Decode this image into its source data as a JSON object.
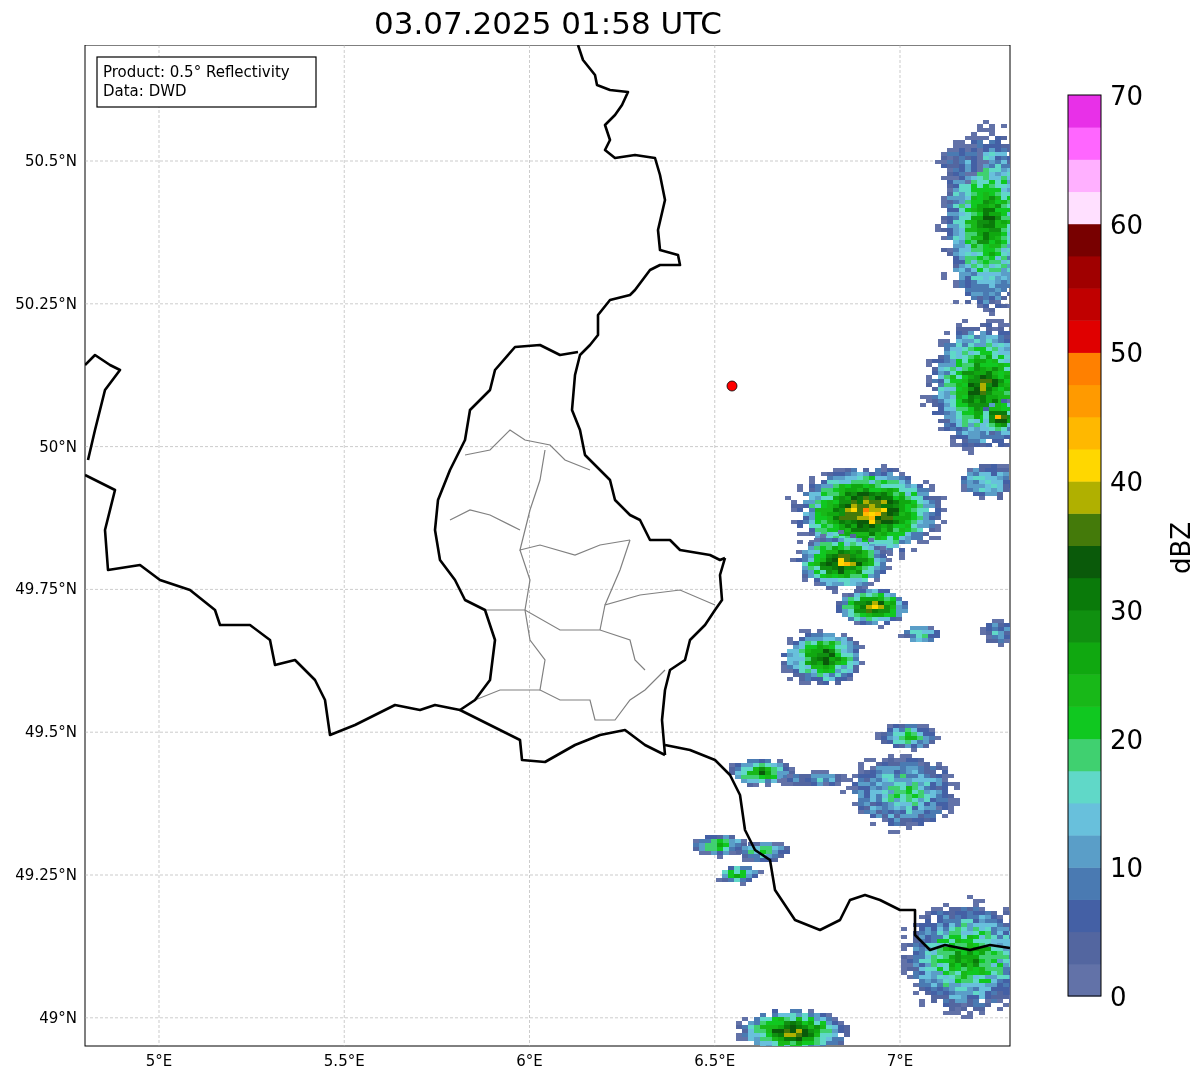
{
  "title": "03.07.2025 01:58 UTC",
  "info_box": {
    "lines": [
      "Product: 0.5° Reflectivity",
      "Data: DWD"
    ]
  },
  "map": {
    "x_ticks": [
      "5°E",
      "5.5°E",
      "6°E",
      "6.5°E",
      "7°E"
    ],
    "y_ticks": [
      "50.5°N",
      "50.25°N",
      "50°N",
      "49.75°N",
      "49.5°N",
      "49.25°N",
      "49°N"
    ]
  },
  "colorbar": {
    "label": "dBZ",
    "ticks": [
      "70",
      "60",
      "50",
      "40",
      "30",
      "20",
      "10",
      "0"
    ],
    "bands": [
      {
        "color": "#6272a8"
      },
      {
        "color": "#5366a0"
      },
      {
        "color": "#4460a5"
      },
      {
        "color": "#4a7ab2"
      },
      {
        "color": "#5a9ec8"
      },
      {
        "color": "#68c0dc"
      },
      {
        "color": "#60d8c8"
      },
      {
        "color": "#40d070"
      },
      {
        "color": "#10c820"
      },
      {
        "color": "#18b818"
      },
      {
        "color": "#10a810"
      },
      {
        "color": "#109010"
      },
      {
        "color": "#0a7a0a"
      },
      {
        "color": "#0a5a0a"
      },
      {
        "color": "#447a0a"
      },
      {
        "color": "#b0b000"
      },
      {
        "color": "#ffd700"
      },
      {
        "color": "#ffb800"
      },
      {
        "color": "#ff9a00"
      },
      {
        "color": "#ff8000"
      },
      {
        "color": "#e00000"
      },
      {
        "color": "#c00000"
      },
      {
        "color": "#a00000"
      },
      {
        "color": "#780000"
      },
      {
        "color": "#ffe0ff"
      },
      {
        "color": "#ffb0ff"
      },
      {
        "color": "#ff66ff"
      },
      {
        "color": "#e830e8"
      }
    ]
  }
}
